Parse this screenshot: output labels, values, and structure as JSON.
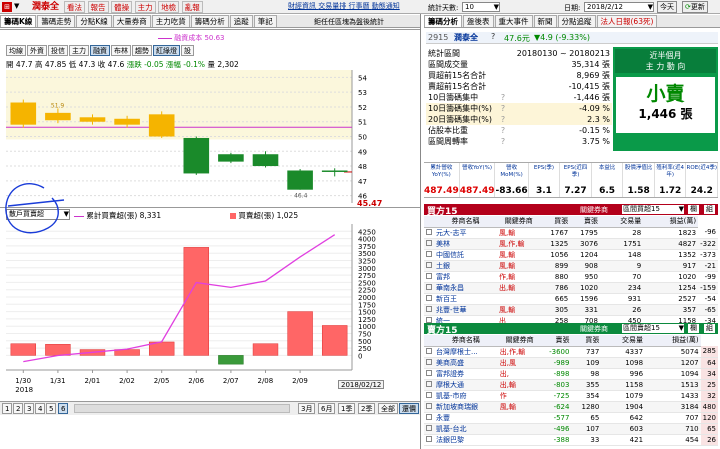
{
  "topbar": {
    "stock_label": "潤泰全",
    "menu": [
      "看法",
      "報告",
      "體操",
      "主力",
      "地檢",
      "亂報"
    ],
    "links": [
      "財經資訊",
      "交易量排",
      "行事曆",
      "動態通知"
    ],
    "count_label": "統計天數:",
    "count_value": "10",
    "date_label": "日期:",
    "date_value": "2018/2/12",
    "today_btn": "今天",
    "refresh_btn": "更新"
  },
  "tabs_left": [
    "籌碼K線",
    "籌碼走勢",
    "分點K線",
    "大量券商",
    "主力吃貨",
    "籌碼分析",
    "追蹤",
    "筆記"
  ],
  "note_text": "鉅任任區塊為盤後統計",
  "chart_toolbar": [
    "均線",
    "外資",
    "投信",
    "主力",
    "融資",
    "布林",
    "趨勢",
    "紅綠燈",
    "設"
  ],
  "ohlc": {
    "open": "開 47.7",
    "high": "高 47.85",
    "low": "低 47.3",
    "close": "收 47.6",
    "chg": "漲跌 -0.05",
    "pct": "漲幅 -0.1%",
    "vol": "量 2,302"
  },
  "cost_legend": "融資成本 50.63",
  "lower_select": "散戶買賣超",
  "legend1": "累計買賣超(張) 8,331",
  "legend2": "買賣超(張) 1,025",
  "price_tag": "45.47",
  "candle_labels": {
    "high": "51.9",
    "low": "46.4"
  },
  "lower_axis_label": "2018/02/12",
  "bottom_bar": {
    "pages": [
      "1",
      "2",
      "3",
      "4",
      "5",
      "6"
    ],
    "periods": [
      "3月",
      "6月",
      "1季",
      "2季",
      "全部",
      "還價"
    ]
  },
  "right_tabs": [
    "籌碼分析",
    "盤後表",
    "重大事件",
    "新聞",
    "分點追蹤",
    "法人日報(63死)"
  ],
  "stock": {
    "code": "2915",
    "name": "潤泰全",
    "price": "47.6元",
    "change": "▼4.9 (-9.33%)"
  },
  "stats": [
    {
      "label": "統計區間",
      "value": "20180130 ~ 20180213"
    },
    {
      "label": "區間成交量",
      "value": "35,314 張"
    },
    {
      "label": "買超前15名合計",
      "value": "8,969 張"
    },
    {
      "label": "賣超前15名合計",
      "value": "-10,415 張"
    },
    {
      "label": "10日籌碼集中",
      "value": "-1,446 張"
    },
    {
      "label": "10日籌碼集中(%)",
      "value": "-4.09 %"
    },
    {
      "label": "20日籌碼集中(%)",
      "value": "2.3 %"
    },
    {
      "label": "佔股本比重",
      "value": "-0.15 %"
    },
    {
      "label": "區間周轉率",
      "value": "3.75 %"
    }
  ],
  "green_panel": {
    "title1": "近半個月",
    "title2": "主 力 動 向",
    "verdict": "小賣",
    "amount": "1,446 張"
  },
  "fin_headers": [
    "累計營收YoY(%)",
    "營收YoY(%)",
    "營收MoM(%)",
    "EPS(季)",
    "EPS(近四季)",
    "本益比",
    "股價淨值比",
    "殖利率(近4年)",
    "ROE(近4季)"
  ],
  "fin_values": [
    "487.49",
    "487.49",
    "-83.66",
    "3.1",
    "7.27",
    "6.5",
    "1.58",
    "1.72",
    "24.2"
  ],
  "buy_table": {
    "title": "買方15",
    "related_label": "關鍵券商",
    "related_value": "區間買超15",
    "btn1": "欄",
    "btn2": "組",
    "headers": [
      "券商名稱",
      "關鍵券商",
      "買張",
      "賣張",
      "交易量",
      "損益(萬)"
    ],
    "rows": [
      [
        "元大-志平",
        "風,輸",
        "1767",
        "1795",
        "28",
        "1823",
        "-96"
      ],
      [
        "美林",
        "風,作,輸",
        "1325",
        "3076",
        "1751",
        "4827",
        "-322"
      ],
      [
        "中國信託",
        "風,輸",
        "1056",
        "1204",
        "148",
        "1352",
        "-373"
      ],
      [
        "土銀",
        "風,輸",
        "899",
        "908",
        "9",
        "917",
        "-21"
      ],
      [
        "富邦",
        "作,輸",
        "880",
        "950",
        "70",
        "1020",
        "-99"
      ],
      [
        "華南永昌",
        "出,輸",
        "786",
        "1020",
        "234",
        "1254",
        "-159"
      ],
      [
        "新百王",
        "",
        "665",
        "1596",
        "931",
        "2527",
        "-54"
      ],
      [
        "兆豐-世華",
        "風,輸",
        "305",
        "331",
        "26",
        "357",
        "-65"
      ],
      [
        "統一",
        "出",
        "258",
        "708",
        "450",
        "1158",
        "-34"
      ]
    ]
  },
  "sell_table": {
    "title": "賣方15",
    "related_label": "關鍵券商",
    "related_value": "區間賣超15",
    "btn1": "欄",
    "btn2": "組",
    "headers": [
      "券商名稱",
      "關鍵券商",
      "賣張",
      "買張",
      "交易量",
      "損益(萬)"
    ],
    "rows": [
      [
        "台灣摩根士...",
        "出,作,輸",
        "-3600",
        "737",
        "4337",
        "5074",
        "285"
      ],
      [
        "美商高盛",
        "出,風",
        "-989",
        "109",
        "1098",
        "1207",
        "64"
      ],
      [
        "富邦證券",
        "出,",
        "-898",
        "98",
        "996",
        "1094",
        "34"
      ],
      [
        "摩根大通",
        "出,輸",
        "-803",
        "355",
        "1158",
        "1513",
        "25"
      ],
      [
        "凱基-市府",
        "作",
        "-725",
        "354",
        "1079",
        "1433",
        "32"
      ],
      [
        "新加坡商瑞銀",
        "風,輸",
        "-624",
        "1280",
        "1904",
        "3184",
        "480"
      ],
      [
        "永豐",
        "",
        "-577",
        "65",
        "642",
        "707",
        "120"
      ],
      [
        "凱基-台北",
        "",
        "-496",
        "107",
        "603",
        "710",
        "65"
      ],
      [
        "法銀巴黎",
        "",
        "-388",
        "33",
        "421",
        "454",
        "26"
      ]
    ]
  },
  "chart_data": [
    {
      "type": "candlestick",
      "categories": [
        "1/30",
        "1/31",
        "2/01",
        "2/02",
        "2/05",
        "2/06",
        "2/07",
        "2/08",
        "2/09",
        "2/12"
      ],
      "ylim": [
        45.5,
        54.5
      ],
      "yticks": [
        46,
        47,
        48,
        49,
        50,
        51,
        52,
        53,
        54
      ],
      "candles": [
        {
          "open": 52.3,
          "close": 50.8,
          "high": 52.5,
          "low": 50.6
        },
        {
          "open": 51.6,
          "close": 51.1,
          "high": 51.9,
          "low": 50.9
        },
        {
          "open": 51.3,
          "close": 51.0,
          "high": 51.5,
          "low": 50.8
        },
        {
          "open": 51.2,
          "close": 50.8,
          "high": 51.4,
          "low": 50.6
        },
        {
          "open": 51.5,
          "close": 50.0,
          "high": 51.7,
          "low": 49.9
        },
        {
          "open": 49.9,
          "close": 47.5,
          "high": 50.0,
          "low": 47.4
        },
        {
          "open": 48.8,
          "close": 48.3,
          "high": 48.9,
          "low": 48.2
        },
        {
          "open": 48.8,
          "close": 48.0,
          "high": 49.0,
          "low": 47.9
        },
        {
          "open": 47.7,
          "close": 46.4,
          "high": 47.8,
          "low": 46.4
        },
        {
          "open": 47.7,
          "close": 47.6,
          "high": 47.85,
          "low": 47.3
        }
      ],
      "cost_line": 50.63,
      "xlabel": "",
      "ylabel": ""
    },
    {
      "type": "bar",
      "categories": [
        "1/30",
        "1/31",
        "2/01",
        "2/02",
        "2/05",
        "2/06",
        "2/07",
        "2/08",
        "2/09",
        "2/12"
      ],
      "xtick_labels": [
        "1/30",
        "1/31",
        "2/01",
        "2/02",
        "2/05",
        "2/06",
        "2/07",
        "2/08",
        "2/09"
      ],
      "x_year_label": "2018",
      "series": [
        {
          "name": "買賣超(張)",
          "values": [
            400,
            380,
            200,
            200,
            460,
            3700,
            -300,
            400,
            1500,
            1025
          ]
        },
        {
          "name": "累計買賣超(張)",
          "values": [
            400,
            780,
            980,
            1180,
            1640,
            5340,
            5040,
            5440,
            6940,
            8331
          ]
        }
      ],
      "ylim": [
        -500,
        4500
      ],
      "yticks": [
        0,
        250,
        500,
        750,
        1000,
        1250,
        1500,
        1750,
        2000,
        2250,
        2500,
        2750,
        3000,
        3250,
        3500,
        3750,
        4000,
        4250
      ],
      "line_ylim": [
        0,
        9000
      ],
      "xlabel": "",
      "ylabel": ""
    }
  ]
}
